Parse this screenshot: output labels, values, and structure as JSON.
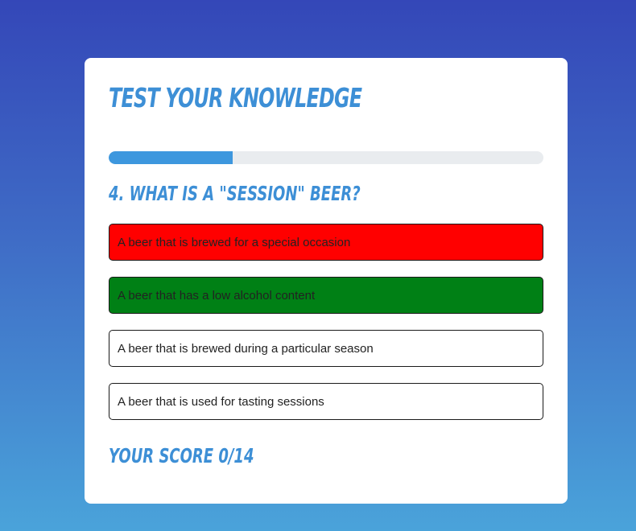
{
  "quiz": {
    "title": "TEST YOUR KNOWLEDGE",
    "progress": 0.2857,
    "question": "4. WHAT IS A \"SESSION\" BEER?",
    "answers": [
      {
        "label": "A beer that is brewed for a special occasion",
        "state": "incorrect"
      },
      {
        "label": "A beer that has a low alcohol content",
        "state": "correct"
      },
      {
        "label": "A beer that is brewed during a particular season",
        "state": "neutral"
      },
      {
        "label": "A beer that is used for tasting sessions",
        "state": "neutral"
      }
    ],
    "score": "YOUR SCORE 0/14"
  },
  "colors": {
    "accent": "#3d8fd6",
    "progress_fill": "#3d97de",
    "progress_track": "#e9ecef",
    "incorrect": "#ff0000",
    "correct": "#008015",
    "neutral": "#ffffff"
  }
}
